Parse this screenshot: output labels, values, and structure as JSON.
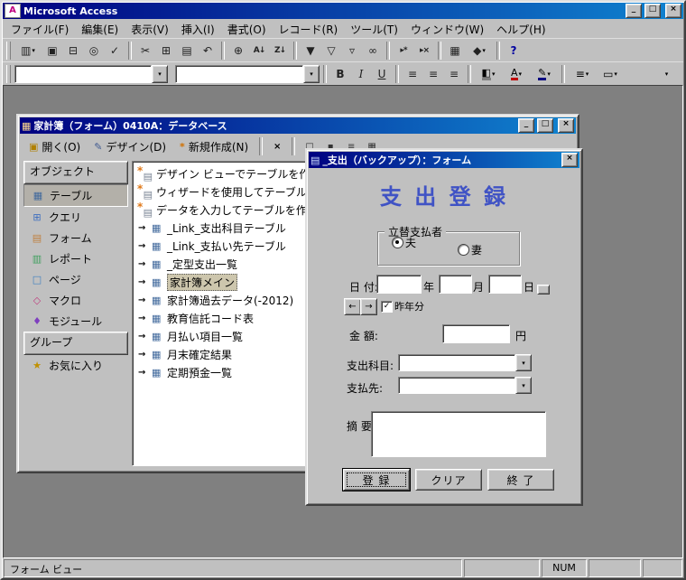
{
  "colors": {
    "titlebar_gradient_start": "#000080",
    "titlebar_gradient_end": "#1084d0",
    "window_chrome": "#c0c0c0",
    "workspace_bg": "#808080",
    "form_heading_blue": "#4053c5",
    "list_selection_tan": "#cdc6ad"
  },
  "icons": {
    "app": "A",
    "minimize": "_",
    "maximize": "□",
    "close": "×",
    "view_form": "▥",
    "dropdown": "▾",
    "save": "▣",
    "print": "⊟",
    "print_preview": "◎",
    "spelling": "✓",
    "cut": "✂",
    "copy": "⊞",
    "paste": "▤",
    "undo": "↶",
    "hyperlink": "⊕",
    "sort_asc": "A↓",
    "sort_desc": "Z↓",
    "filter_by_selection": "▼",
    "filter_by_form": "▽",
    "apply_filter": "▿",
    "find": "∞",
    "new_record": "▸*",
    "delete_record": "▸×",
    "database_window": "▦",
    "new_object": "◆",
    "help": "?",
    "bold": "B",
    "italic": "I",
    "underline": "U",
    "align_left": "≡",
    "align_center": "≡",
    "align_right": "≡",
    "fill_color": "◧",
    "font_color": "A",
    "line_color": "✎",
    "border_width": "≡",
    "special_effect": "▭",
    "db_window_title": "▦",
    "form_window_title": "▤",
    "db_open": "▣",
    "db_design": "✎",
    "db_new": "*",
    "db_delete": "×",
    "view_large": "□",
    "view_small": "▪",
    "view_list": "≡",
    "view_details": "▦",
    "obj_table": "▦",
    "obj_query": "⊞",
    "obj_form": "▤",
    "obj_report": "▥",
    "obj_page": "□",
    "obj_macro": "◇",
    "obj_module": "♦",
    "favorites": "★",
    "shortcut_sheet": "▤",
    "shortcut_spark": "*",
    "link_arrow": "→",
    "list_table": "▦",
    "check": "✓",
    "combo_arrow": "▾"
  },
  "app": {
    "title": "Microsoft Access",
    "menu": [
      "ファイル(F)",
      "編集(E)",
      "表示(V)",
      "挿入(I)",
      "書式(O)",
      "レコード(R)",
      "ツール(T)",
      "ウィンドウ(W)",
      "ヘルプ(H)"
    ]
  },
  "status": {
    "mode": "フォーム ビュー",
    "panels": [
      "",
      "NUM",
      "",
      ""
    ]
  },
  "db": {
    "title": "家計簿（フォーム）0410A：データベース",
    "toolbar": {
      "open": "開く(O)",
      "design": "デザイン(D)",
      "new": "新規作成(N)"
    },
    "sidebar": {
      "objects_header": "オブジェクト",
      "objects": [
        "テーブル",
        "クエリ",
        "フォーム",
        "レポート",
        "ページ",
        "マクロ",
        "モジュール"
      ],
      "groups_header": "グループ",
      "groups": [
        "お気に入り"
      ]
    },
    "list": {
      "shortcuts": [
        "デザイン ビューでテーブルを作",
        "ウィザードを使用してテーブルを",
        "データを入力してテーブルを作"
      ],
      "tables": [
        "_Link_支出科目テーブル",
        "_Link_支払い先テーブル",
        "_定型支出一覧",
        "家計簿メイン",
        "家計簿過去データ(-2012)",
        "教育信託コード表",
        "月払い項目一覧",
        "月末確定結果",
        "定期預金一覧"
      ],
      "selected": "家計簿メイン"
    }
  },
  "form": {
    "title": "_支出（バックアップ）：フォーム",
    "heading": "支 出 登 録",
    "payer": {
      "label": "立替支払者",
      "husband": "夫",
      "wife": "妻",
      "selected": "夫"
    },
    "date": {
      "label": "日 付:",
      "year": "年",
      "month": "月",
      "day": "日"
    },
    "nav": {
      "prev": "←",
      "next": "→",
      "lastyear": "昨年分"
    },
    "amount": {
      "label": "金 額:",
      "unit": "円"
    },
    "category_label": "支出科目:",
    "payee_label": "支払先:",
    "memo_label": "摘 要:",
    "buttons": {
      "register": "登 録",
      "clear": "クリア",
      "close": "終 了"
    }
  }
}
